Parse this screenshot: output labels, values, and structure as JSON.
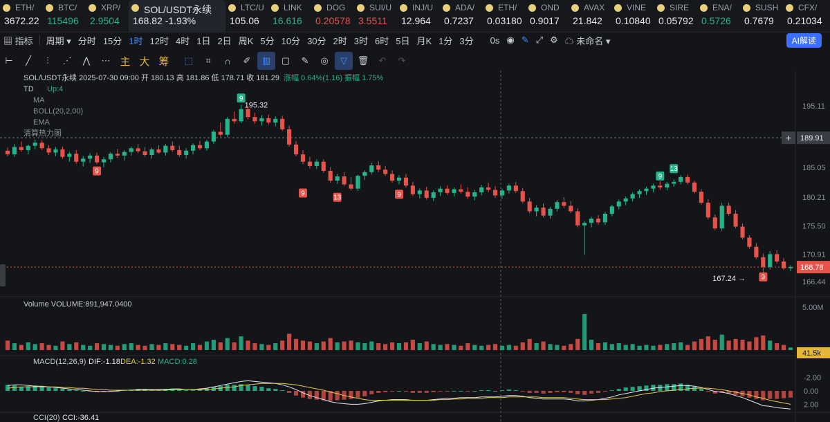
{
  "ticker": [
    {
      "name": "ETH/",
      "price": "3672.22",
      "dir": "wt"
    },
    {
      "name": "BTC/",
      "price": "115496",
      "dir": "up"
    },
    {
      "name": "XRP/",
      "price": "2.9504",
      "dir": "up"
    },
    {
      "name": "SOL/USDT永续",
      "price": "168.82  -1.93%",
      "dir": "wt",
      "active": true
    },
    {
      "name": "LTC/U",
      "price": "105.06",
      "dir": "wt"
    },
    {
      "name": "LINK",
      "price": "16.616",
      "dir": "up"
    },
    {
      "name": "DOG",
      "price": "0.20578",
      "dir": "dn"
    },
    {
      "name": "SUI/U",
      "price": "3.5511",
      "dir": "dn"
    },
    {
      "name": "INJ/U",
      "price": "12.964",
      "dir": "wt"
    },
    {
      "name": "ADA/",
      "price": "0.7237",
      "dir": "wt"
    },
    {
      "name": "ETH/",
      "price": "0.03180",
      "dir": "wt"
    },
    {
      "name": "OND",
      "price": "0.9017",
      "dir": "wt"
    },
    {
      "name": "AVAX",
      "price": "21.842",
      "dir": "wt"
    },
    {
      "name": "VINE",
      "price": "0.10840",
      "dir": "wt"
    },
    {
      "name": "SIRE",
      "price": "0.05792",
      "dir": "wt"
    },
    {
      "name": "ENA/",
      "price": "0.5726",
      "dir": "up"
    },
    {
      "name": "SUSH",
      "price": "0.7679",
      "dir": "wt"
    },
    {
      "name": "CFX/",
      "price": "0.21034",
      "dir": "wt"
    }
  ],
  "toolbar": {
    "indicator": "指标",
    "period": "周期",
    "intervals": [
      "分时",
      "15分",
      "1时",
      "12时",
      "4时",
      "1日",
      "2日",
      "周K",
      "5分",
      "10分",
      "30分",
      "2时",
      "3时",
      "6时",
      "5日",
      "月K",
      "1分",
      "3分"
    ],
    "selected": "1时",
    "countdown": "0s",
    "layout_name": "未命名",
    "ai": "AI解读"
  },
  "drawing_tools": {
    "main": "主",
    "big": "大",
    "chip": "筹"
  },
  "info": {
    "symbol": "SOL/USDT永续",
    "time": "2025-07-30 09:00",
    "open_label": "开",
    "open": "180.13",
    "high_label": "高",
    "high": "181.86",
    "low_label": "低",
    "low": "178.71",
    "close_label": "收",
    "close": "181.29",
    "chg_label": "涨幅",
    "chg": "0.64%(1.16)",
    "amp_label": "振幅",
    "amp": "1.75%"
  },
  "overlays": {
    "td": "TD",
    "td_val": "Up:4",
    "ma": "MA",
    "boll": "BOLL(20,2,00)",
    "ema": "EMA",
    "liq": "清算热力图"
  },
  "price_axis": [
    "195.11",
    "190.31",
    "185.05",
    "180.21",
    "175.50",
    "170.91",
    "166.44"
  ],
  "cross_price": "189.91",
  "last_price": "168.78",
  "markers": {
    "high": "195.32",
    "low": "167.24"
  },
  "volume": {
    "label": "Volume",
    "value": "VOLUME:891,947.0400",
    "axis_max": "5.00M",
    "last": "41.5k"
  },
  "macd": {
    "label": "MACD(12,26,9)",
    "dif": "DIF:-1.18",
    "dea": "DEA:-1.32",
    "macd": "MACD:0.28",
    "axis": [
      "2.00",
      "0.00",
      "-2.00"
    ]
  },
  "cci": {
    "label": "CCI(20)",
    "value": "CCI:-36.41"
  },
  "colors": {
    "up": "#26b389",
    "down": "#e5534b",
    "dif": "#e6e8ec",
    "dea": "#e5c94b",
    "accent": "#3d8cff"
  },
  "chart_data": {
    "type": "candlestick",
    "interval": "1时",
    "ylim": [
      164.5,
      197.5
    ],
    "candles": [
      [
        187.8,
        188.3,
        186.9,
        187.2
      ],
      [
        187.2,
        188.9,
        186.8,
        188.4
      ],
      [
        188.4,
        189.3,
        187.6,
        187.9
      ],
      [
        187.9,
        188.8,
        187.2,
        188.6
      ],
      [
        188.6,
        189.6,
        188.0,
        189.1
      ],
      [
        189.1,
        189.5,
        187.9,
        188.2
      ],
      [
        188.2,
        188.7,
        187.1,
        187.5
      ],
      [
        187.5,
        188.4,
        186.9,
        188.0
      ],
      [
        188.0,
        188.5,
        186.5,
        186.8
      ],
      [
        186.8,
        187.6,
        186.0,
        187.3
      ],
      [
        187.3,
        187.9,
        185.7,
        186.0
      ],
      [
        186.0,
        186.9,
        185.2,
        186.5
      ],
      [
        186.5,
        187.4,
        185.8,
        187.0
      ],
      [
        187.0,
        187.5,
        185.6,
        185.9
      ],
      [
        185.9,
        186.8,
        185.1,
        186.4
      ],
      [
        186.4,
        187.6,
        185.9,
        187.3
      ],
      [
        187.3,
        188.1,
        186.6,
        187.0
      ],
      [
        187.0,
        187.9,
        186.2,
        187.6
      ],
      [
        187.6,
        188.5,
        187.0,
        188.2
      ],
      [
        188.2,
        188.9,
        187.4,
        187.7
      ],
      [
        187.7,
        188.4,
        186.8,
        187.1
      ],
      [
        187.1,
        188.3,
        186.5,
        188.0
      ],
      [
        188.0,
        188.7,
        187.3,
        187.5
      ],
      [
        187.5,
        188.9,
        187.0,
        188.6
      ],
      [
        188.6,
        189.3,
        187.6,
        187.9
      ],
      [
        187.9,
        188.6,
        186.8,
        187.1
      ],
      [
        187.1,
        188.2,
        186.5,
        187.8
      ],
      [
        187.8,
        189.0,
        187.2,
        188.7
      ],
      [
        188.7,
        189.4,
        187.9,
        188.2
      ],
      [
        188.2,
        189.6,
        187.8,
        189.3
      ],
      [
        189.3,
        191.2,
        188.9,
        190.9
      ],
      [
        190.9,
        192.4,
        190.1,
        190.4
      ],
      [
        190.4,
        193.3,
        190.0,
        193.0
      ],
      [
        193.0,
        194.2,
        192.2,
        192.6
      ],
      [
        192.6,
        195.32,
        192.3,
        194.6
      ],
      [
        194.6,
        195.0,
        192.9,
        193.3
      ],
      [
        193.3,
        194.0,
        192.2,
        192.6
      ],
      [
        192.6,
        193.6,
        191.9,
        193.1
      ],
      [
        193.1,
        193.7,
        192.1,
        192.4
      ],
      [
        192.4,
        193.4,
        191.8,
        193.0
      ],
      [
        193.0,
        193.5,
        191.0,
        191.3
      ],
      [
        191.3,
        191.9,
        188.5,
        188.8
      ],
      [
        188.8,
        189.4,
        186.9,
        187.2
      ],
      [
        187.2,
        187.9,
        185.6,
        186.0
      ],
      [
        186.0,
        186.8,
        184.9,
        185.3
      ],
      [
        185.3,
        186.4,
        184.8,
        186.0
      ],
      [
        186.0,
        186.4,
        184.2,
        184.5
      ],
      [
        184.5,
        185.1,
        182.6,
        182.9
      ],
      [
        182.9,
        184.0,
        182.4,
        183.6
      ],
      [
        183.6,
        184.3,
        182.0,
        182.3
      ],
      [
        182.3,
        183.5,
        181.3,
        181.6
      ],
      [
        181.6,
        183.9,
        181.2,
        183.7
      ],
      [
        183.7,
        184.6,
        183.0,
        184.3
      ],
      [
        184.3,
        185.8,
        183.9,
        185.4
      ],
      [
        185.4,
        186.1,
        184.3,
        184.7
      ],
      [
        184.7,
        185.3,
        183.7,
        184.0
      ],
      [
        184.0,
        184.6,
        182.6,
        182.9
      ],
      [
        182.9,
        183.8,
        182.3,
        183.4
      ],
      [
        183.4,
        184.0,
        181.8,
        182.1
      ],
      [
        182.1,
        182.7,
        180.4,
        180.7
      ],
      [
        180.7,
        181.6,
        180.0,
        181.3
      ],
      [
        181.3,
        181.9,
        179.8,
        180.1
      ],
      [
        180.1,
        181.3,
        179.6,
        181.0
      ],
      [
        181.0,
        182.0,
        180.4,
        181.6
      ],
      [
        181.6,
        182.1,
        180.6,
        180.9
      ],
      [
        180.9,
        181.8,
        180.3,
        181.5
      ],
      [
        181.5,
        182.3,
        180.8,
        181.1
      ],
      [
        181.1,
        181.8,
        179.9,
        180.3
      ],
      [
        180.3,
        181.4,
        179.7,
        181.0
      ],
      [
        181.0,
        182.2,
        180.5,
        181.8
      ],
      [
        181.8,
        182.6,
        181.0,
        181.4
      ],
      [
        181.4,
        182.0,
        180.1,
        180.5
      ],
      [
        180.5,
        181.6,
        179.9,
        181.3
      ],
      [
        181.3,
        182.4,
        180.8,
        182.1
      ],
      [
        182.1,
        182.7,
        180.9,
        181.2
      ],
      [
        181.2,
        181.7,
        179.2,
        179.5
      ],
      [
        179.5,
        180.1,
        177.6,
        177.9
      ],
      [
        177.9,
        178.9,
        177.1,
        178.5
      ],
      [
        178.5,
        179.2,
        176.9,
        177.2
      ],
      [
        177.2,
        178.6,
        176.7,
        178.3
      ],
      [
        178.3,
        179.7,
        177.9,
        179.4
      ],
      [
        179.4,
        180.2,
        178.4,
        178.8
      ],
      [
        178.8,
        179.6,
        177.6,
        177.9
      ],
      [
        177.9,
        178.4,
        175.3,
        175.6
      ],
      [
        175.6,
        176.3,
        170.8,
        176.0
      ],
      [
        176.0,
        177.0,
        175.3,
        176.7
      ],
      [
        176.7,
        177.3,
        175.7,
        176.1
      ],
      [
        176.1,
        177.8,
        175.7,
        177.5
      ],
      [
        177.5,
        179.0,
        177.1,
        178.7
      ],
      [
        178.7,
        179.8,
        178.2,
        179.5
      ],
      [
        179.5,
        180.3,
        178.9,
        180.0
      ],
      [
        180.0,
        181.0,
        179.5,
        180.7
      ],
      [
        180.7,
        181.5,
        180.1,
        181.2
      ],
      [
        181.2,
        181.9,
        180.6,
        181.6
      ],
      [
        181.6,
        182.4,
        181.0,
        182.1
      ],
      [
        182.1,
        182.8,
        181.4,
        181.8
      ],
      [
        181.8,
        182.7,
        181.3,
        182.4
      ],
      [
        182.4,
        183.1,
        181.9,
        182.7
      ],
      [
        182.7,
        183.8,
        182.3,
        183.5
      ],
      [
        183.5,
        183.9,
        182.3,
        182.6
      ],
      [
        182.6,
        182.9,
        180.8,
        181.1
      ],
      [
        181.1,
        181.5,
        179.0,
        179.3
      ],
      [
        179.3,
        179.9,
        176.6,
        176.9
      ],
      [
        176.9,
        177.4,
        174.8,
        175.1
      ],
      [
        175.1,
        179.3,
        174.7,
        178.8
      ],
      [
        178.8,
        179.3,
        177.2,
        177.5
      ],
      [
        177.5,
        178.1,
        175.1,
        175.4
      ],
      [
        175.4,
        175.9,
        173.3,
        173.6
      ],
      [
        173.6,
        174.0,
        171.8,
        172.1
      ],
      [
        172.1,
        172.7,
        170.1,
        170.4
      ],
      [
        170.4,
        171.0,
        167.24,
        168.8
      ],
      [
        168.8,
        171.4,
        168.4,
        170.9
      ],
      [
        170.9,
        171.6,
        169.4,
        169.7
      ],
      [
        169.7,
        170.3,
        168.3,
        168.6
      ],
      [
        168.6,
        169.1,
        168.1,
        168.78
      ]
    ],
    "volume": [
      1.1,
      0.8,
      0.6,
      0.9,
      0.7,
      0.8,
      0.6,
      0.5,
      1.0,
      0.7,
      0.9,
      0.6,
      0.5,
      0.8,
      0.7,
      0.6,
      0.5,
      0.7,
      0.8,
      0.6,
      0.5,
      0.7,
      0.6,
      0.8,
      0.7,
      0.6,
      0.5,
      0.8,
      0.6,
      1.0,
      1.2,
      0.9,
      1.4,
      0.9,
      1.6,
      1.1,
      0.8,
      0.7,
      0.6,
      0.8,
      1.1,
      1.9,
      1.3,
      1.1,
      1.0,
      0.8,
      1.0,
      1.4,
      0.9,
      1.0,
      1.1,
      0.9,
      0.8,
      1.0,
      0.8,
      0.7,
      0.9,
      0.8,
      0.9,
      1.2,
      0.8,
      1.0,
      0.7,
      0.6,
      0.7,
      0.6,
      0.5,
      0.8,
      0.6,
      0.5,
      0.6,
      0.7,
      0.5,
      0.6,
      0.5,
      0.9,
      1.3,
      0.8,
      1.0,
      0.7,
      0.6,
      0.5,
      0.7,
      1.3,
      4.2,
      1.2,
      0.8,
      0.9,
      0.7,
      0.8,
      0.6,
      0.7,
      0.5,
      0.6,
      0.5,
      0.6,
      0.7,
      0.8,
      0.9,
      0.6,
      1.0,
      1.3,
      1.6,
      1.2,
      1.8,
      1.1,
      1.3,
      1.2,
      1.0,
      1.5,
      1.7,
      1.1,
      0.8,
      0.6,
      0.3
    ],
    "macd_hist": [
      0.9,
      0.8,
      0.6,
      0.7,
      0.8,
      0.7,
      0.5,
      0.4,
      0.3,
      0.2,
      0.1,
      0.0,
      -0.1,
      -0.2,
      -0.2,
      -0.1,
      0.0,
      0.1,
      0.2,
      0.3,
      0.3,
      0.2,
      0.2,
      0.3,
      0.3,
      0.2,
      0.1,
      0.2,
      0.3,
      0.4,
      0.6,
      0.7,
      0.9,
      0.9,
      1.0,
      0.9,
      0.7,
      0.6,
      0.4,
      0.3,
      0.1,
      -0.3,
      -0.7,
      -1.0,
      -1.2,
      -1.3,
      -1.4,
      -1.5,
      -1.4,
      -1.3,
      -1.2,
      -1.0,
      -0.8,
      -0.5,
      -0.3,
      -0.2,
      -0.1,
      0.0,
      -0.1,
      -0.3,
      -0.3,
      -0.3,
      -0.2,
      -0.1,
      -0.1,
      0.0,
      0.0,
      -0.1,
      0.0,
      0.1,
      0.1,
      0.0,
      0.1,
      0.2,
      0.1,
      -0.1,
      -0.3,
      -0.3,
      -0.4,
      -0.3,
      -0.2,
      -0.2,
      -0.3,
      -0.5,
      -0.6,
      -0.4,
      -0.3,
      -0.1,
      0.1,
      0.3,
      0.5,
      0.6,
      0.7,
      0.8,
      0.9,
      0.9,
      1.0,
      1.0,
      1.1,
      0.9,
      0.6,
      0.3,
      -0.1,
      -0.4,
      -0.3,
      -0.4,
      -0.6,
      -0.8,
      -1.0,
      -1.2,
      -1.4,
      -1.2,
      -1.2,
      -1.1,
      -1.0
    ],
    "dif": [
      0.8,
      0.9,
      0.9,
      0.8,
      0.7,
      0.7,
      0.6,
      0.5,
      0.4,
      0.3,
      0.2,
      0.1,
      0.0,
      -0.1,
      -0.1,
      -0.1,
      0.0,
      0.1,
      0.1,
      0.2,
      0.2,
      0.2,
      0.2,
      0.2,
      0.3,
      0.3,
      0.2,
      0.2,
      0.3,
      0.4,
      0.6,
      0.8,
      1.0,
      1.2,
      1.4,
      1.5,
      1.4,
      1.3,
      1.2,
      1.1,
      0.9,
      0.6,
      0.2,
      -0.3,
      -0.7,
      -1.0,
      -1.3,
      -1.6,
      -1.8,
      -1.9,
      -2.0,
      -2.0,
      -1.9,
      -1.7,
      -1.5,
      -1.4,
      -1.3,
      -1.3,
      -1.3,
      -1.4,
      -1.4,
      -1.4,
      -1.3,
      -1.2,
      -1.1,
      -1.1,
      -1.0,
      -1.0,
      -1.0,
      -0.9,
      -0.9,
      -0.9,
      -0.8,
      -0.7,
      -0.7,
      -0.8,
      -1.0,
      -1.1,
      -1.2,
      -1.2,
      -1.2,
      -1.2,
      -1.3,
      -1.5,
      -1.5,
      -1.4,
      -1.3,
      -1.1,
      -0.9,
      -0.6,
      -0.4,
      -0.2,
      0.0,
      0.2,
      0.4,
      0.5,
      0.6,
      0.7,
      0.8,
      0.8,
      0.7,
      0.5,
      0.2,
      -0.1,
      -0.2,
      -0.4,
      -0.7,
      -1.0,
      -1.4,
      -1.8,
      -2.2,
      -2.3,
      -2.5,
      -2.6,
      -2.7
    ],
    "dea": [
      0.4,
      0.5,
      0.6,
      0.6,
      0.6,
      0.6,
      0.6,
      0.6,
      0.5,
      0.5,
      0.4,
      0.4,
      0.3,
      0.2,
      0.2,
      0.1,
      0.1,
      0.1,
      0.1,
      0.1,
      0.1,
      0.1,
      0.1,
      0.1,
      0.2,
      0.2,
      0.2,
      0.2,
      0.2,
      0.2,
      0.3,
      0.4,
      0.5,
      0.6,
      0.8,
      0.9,
      1.0,
      1.1,
      1.1,
      1.1,
      1.1,
      1.0,
      0.9,
      0.7,
      0.5,
      0.3,
      0.1,
      -0.2,
      -0.4,
      -0.7,
      -0.9,
      -1.1,
      -1.3,
      -1.4,
      -1.4,
      -1.4,
      -1.4,
      -1.4,
      -1.4,
      -1.4,
      -1.4,
      -1.4,
      -1.4,
      -1.3,
      -1.3,
      -1.2,
      -1.2,
      -1.1,
      -1.1,
      -1.1,
      -1.0,
      -1.0,
      -1.0,
      -0.9,
      -0.9,
      -0.9,
      -0.9,
      -0.9,
      -1.0,
      -1.0,
      -1.0,
      -1.0,
      -1.1,
      -1.2,
      -1.3,
      -1.3,
      -1.3,
      -1.3,
      -1.2,
      -1.1,
      -1.0,
      -0.8,
      -0.6,
      -0.4,
      -0.3,
      -0.1,
      0.0,
      0.1,
      0.2,
      0.3,
      0.4,
      0.4,
      0.4,
      0.3,
      0.2,
      0.0,
      -0.2,
      -0.4,
      -0.6,
      -0.9,
      -1.1,
      -1.4,
      -1.6,
      -1.8,
      -2.0
    ]
  }
}
